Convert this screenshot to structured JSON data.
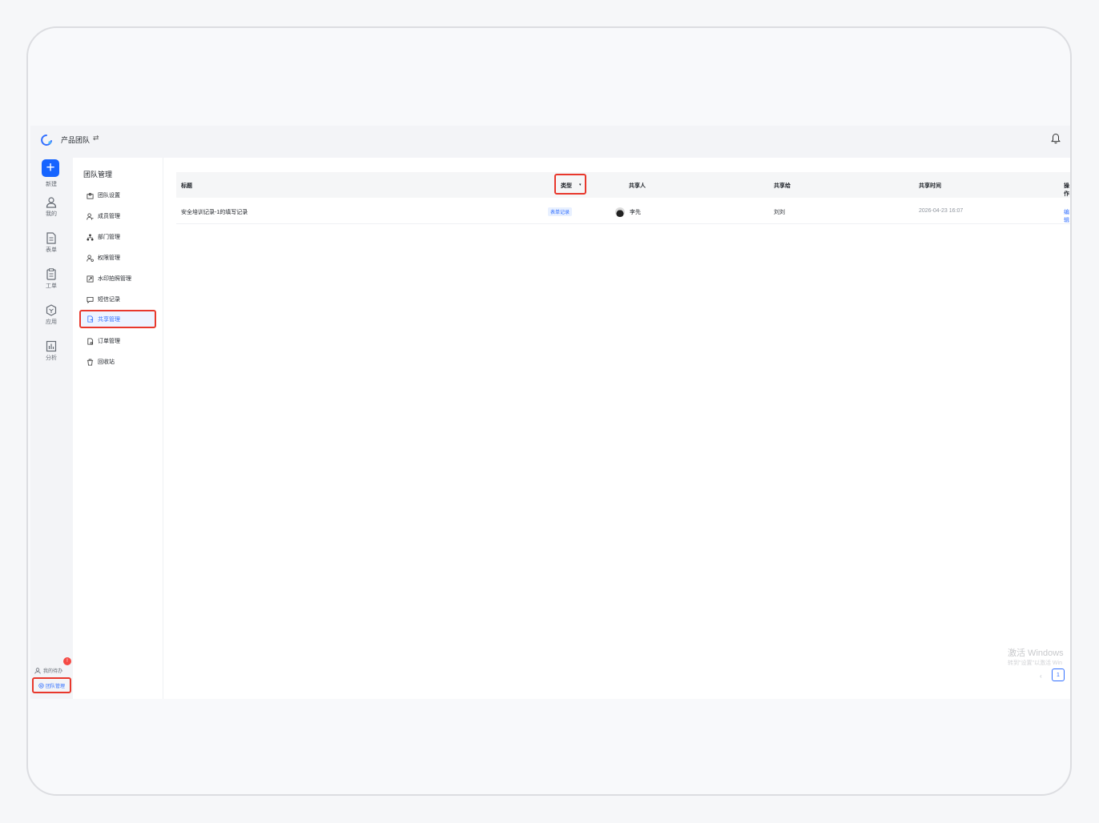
{
  "header": {
    "team_name": "产品团队",
    "swap_glyph": "⇄",
    "logo_icon": "app-logo-icon",
    "bell_icon": "bell-icon"
  },
  "rail": {
    "new_label": "新建",
    "items": [
      {
        "label": "我的",
        "icon": "user-icon"
      },
      {
        "label": "表单",
        "icon": "document-icon"
      },
      {
        "label": "工单",
        "icon": "clipboard-icon"
      },
      {
        "label": "应用",
        "icon": "app-hex-icon"
      },
      {
        "label": "分析",
        "icon": "chart-icon"
      }
    ],
    "todo_label": "我的待办",
    "todo_badge": "!",
    "team_admin_label": "团队管理"
  },
  "subnav": {
    "title": "团队管理",
    "items": [
      {
        "label": "团队设置",
        "icon": "team-settings-icon"
      },
      {
        "label": "成员管理",
        "icon": "members-icon"
      },
      {
        "label": "部门管理",
        "icon": "org-icon"
      },
      {
        "label": "权限管理",
        "icon": "permission-icon"
      },
      {
        "label": "水印拍照管理",
        "icon": "watermark-icon"
      },
      {
        "label": "短信记录",
        "icon": "message-icon"
      },
      {
        "label": "共享管理",
        "icon": "share-icon",
        "active": true
      },
      {
        "label": "订单管理",
        "icon": "order-icon"
      },
      {
        "label": "回收站",
        "icon": "trash-icon"
      }
    ]
  },
  "table": {
    "columns": {
      "title": "标题",
      "type": "类型",
      "sharer": "共享人",
      "shared_to": "共享给",
      "time": "共享时间",
      "actions": "操作"
    },
    "rows": [
      {
        "title": "安全培训记录-1的填写记录",
        "type": "表单记录",
        "sharer": "李先",
        "shared_to": "刘刘",
        "time": "2026-04-23 16:07",
        "action": "编辑"
      }
    ]
  },
  "watermark": {
    "line1": "激活 Windows",
    "line2": "转到\"设置\"以激活 Win"
  },
  "pagination": {
    "prev": "‹",
    "current": "1"
  },
  "colors": {
    "accent": "#1664ff",
    "link": "#3370ff",
    "highlight_box": "#e8382c"
  }
}
